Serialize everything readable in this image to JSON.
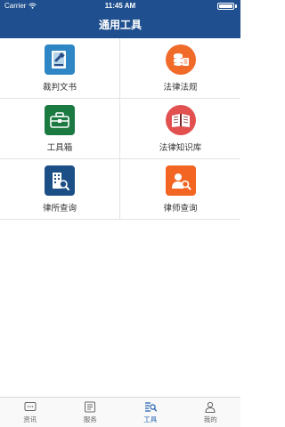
{
  "status_bar": {
    "carrier": "Carrier",
    "time": "11:45 AM",
    "icons": [
      "wifi-icon",
      "battery-icon"
    ]
  },
  "nav": {
    "title": "通用工具"
  },
  "tools": [
    {
      "label": "裁判文书",
      "icon": "judgment-book-icon",
      "color": "#2f86c4"
    },
    {
      "label": "法律法规",
      "icon": "law-coins-icon",
      "color": "#f06a2a"
    },
    {
      "label": "工具箱",
      "icon": "toolbox-icon",
      "color": "#1b7a42"
    },
    {
      "label": "法律知识库",
      "icon": "knowledge-book-icon",
      "color": "#e25050"
    },
    {
      "label": "律所查询",
      "icon": "law-firm-search-icon",
      "color": "#1d4f87"
    },
    {
      "label": "律师查询",
      "icon": "lawyer-search-icon",
      "color": "#f26522"
    }
  ],
  "tabbar": {
    "items": [
      {
        "label": "资讯",
        "icon": "news-icon",
        "active": false
      },
      {
        "label": "服务",
        "icon": "service-icon",
        "active": false
      },
      {
        "label": "工具",
        "icon": "tools-icon",
        "active": true
      },
      {
        "label": "我的",
        "icon": "profile-icon",
        "active": false
      }
    ],
    "active_color": "#1f5fae"
  },
  "colors": {
    "brand": "#1f4f8f"
  }
}
